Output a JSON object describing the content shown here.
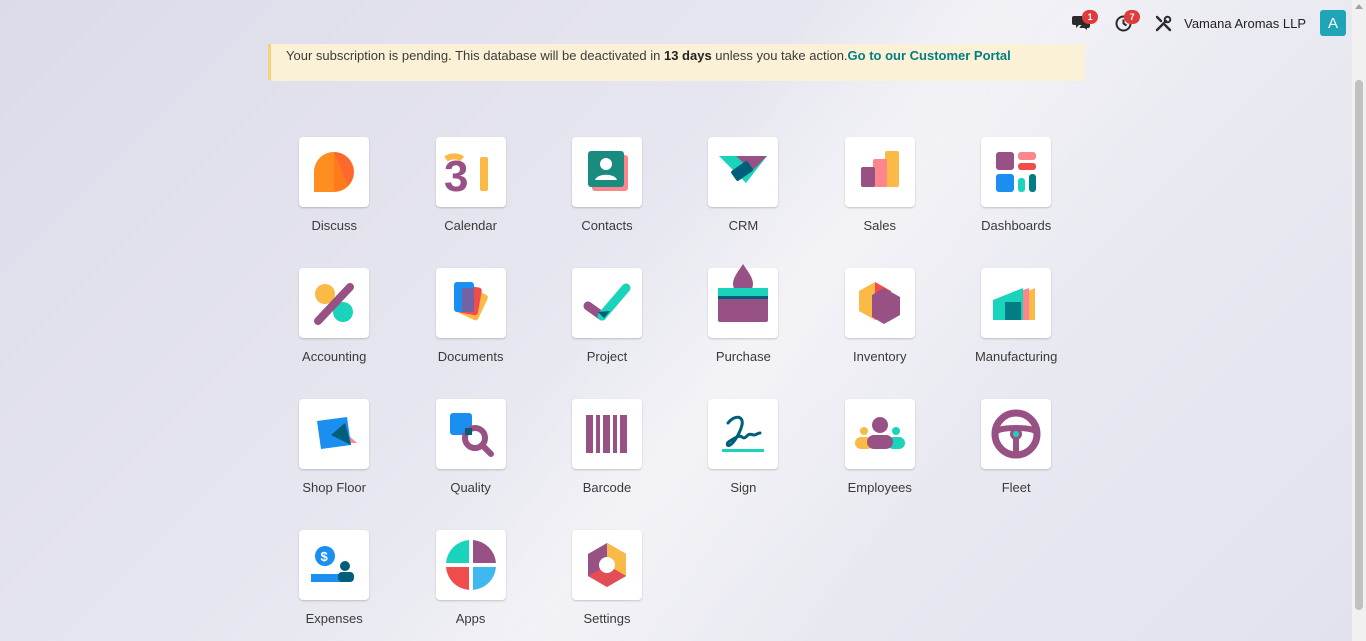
{
  "topbar": {
    "chat_badge": "1",
    "activity_badge": "7",
    "company": "Vamana Aromas LLP",
    "avatar_letter": "A"
  },
  "banner": {
    "text_before": "Your subscription is pending. This database will be deactivated in ",
    "days": "13 days",
    "text_after": " unless you take action.",
    "link": "Go to our Customer Portal"
  },
  "apps": [
    {
      "label": "Discuss",
      "icon": "discuss-icon"
    },
    {
      "label": "Calendar",
      "icon": "calendar-icon"
    },
    {
      "label": "Contacts",
      "icon": "contacts-icon"
    },
    {
      "label": "CRM",
      "icon": "crm-icon"
    },
    {
      "label": "Sales",
      "icon": "sales-icon"
    },
    {
      "label": "Dashboards",
      "icon": "dashboards-icon"
    },
    {
      "label": "Accounting",
      "icon": "accounting-icon"
    },
    {
      "label": "Documents",
      "icon": "documents-icon"
    },
    {
      "label": "Project",
      "icon": "project-icon"
    },
    {
      "label": "Purchase",
      "icon": "purchase-icon"
    },
    {
      "label": "Inventory",
      "icon": "inventory-icon"
    },
    {
      "label": "Manufacturing",
      "icon": "manufacturing-icon"
    },
    {
      "label": "Shop Floor",
      "icon": "shop-floor-icon"
    },
    {
      "label": "Quality",
      "icon": "quality-icon"
    },
    {
      "label": "Barcode",
      "icon": "barcode-icon"
    },
    {
      "label": "Sign",
      "icon": "sign-icon"
    },
    {
      "label": "Employees",
      "icon": "employees-icon"
    },
    {
      "label": "Fleet",
      "icon": "fleet-icon"
    },
    {
      "label": "Expenses",
      "icon": "expenses-icon"
    },
    {
      "label": "Apps",
      "icon": "apps-icon"
    },
    {
      "label": "Settings",
      "icon": "settings-icon"
    }
  ],
  "colors": {
    "purple": "#985184",
    "teal": "#1ad3bb",
    "dark_teal": "#005e7a",
    "orange": "#fc868b",
    "accent_link": "#017e84",
    "avatar": "#1fa5b5"
  }
}
